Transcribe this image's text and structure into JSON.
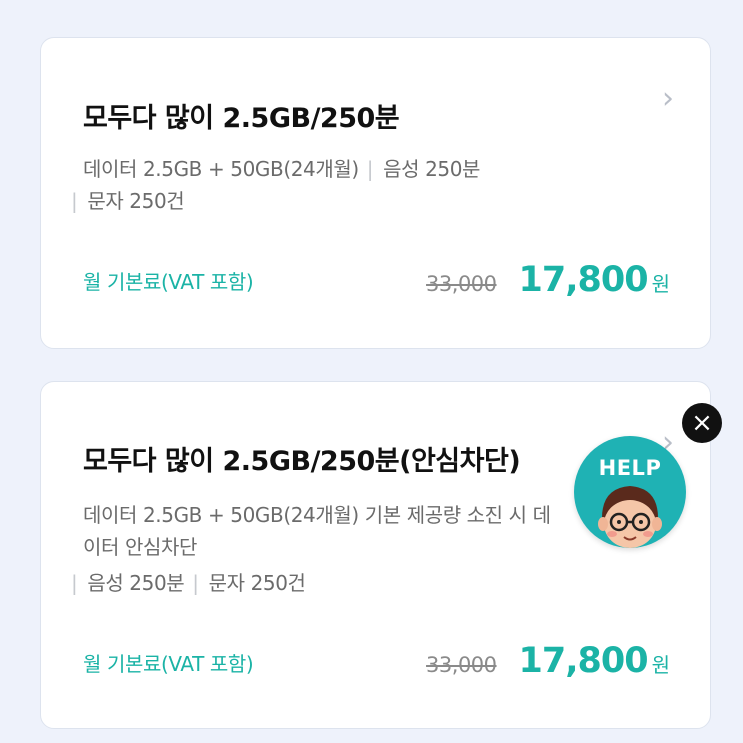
{
  "plans": [
    {
      "title": "모두다 많이 2.5GB/250분",
      "desc_line1_a": "데이터 2.5GB + 50GB(24개월)",
      "desc_line1_b": "음성 250분",
      "desc_line2": "문자 250건",
      "fee_label": "월 기본료(VAT 포함)",
      "old_price": "33,000",
      "price": "17,800",
      "currency": "원"
    },
    {
      "title": "모두다 많이 2.5GB/250분(안심차단)",
      "desc_line1": "데이터 2.5GB + 50GB(24개월) 기본 제공량 소진 시 데",
      "desc_line2": "이터 안심차단",
      "desc_line3_a": "음성 250분",
      "desc_line3_b": "문자 250건",
      "fee_label": "월 기본료(VAT 포함)",
      "old_price": "33,000",
      "price": "17,800",
      "currency": "원"
    }
  ],
  "separator": "|",
  "chevron_icon": "›",
  "help_widget": {
    "label": "HELP",
    "close_icon": "×"
  },
  "colors": {
    "accent": "#1bb3a6",
    "help_bg": "#1fb2b4",
    "background": "#eef2fb"
  }
}
